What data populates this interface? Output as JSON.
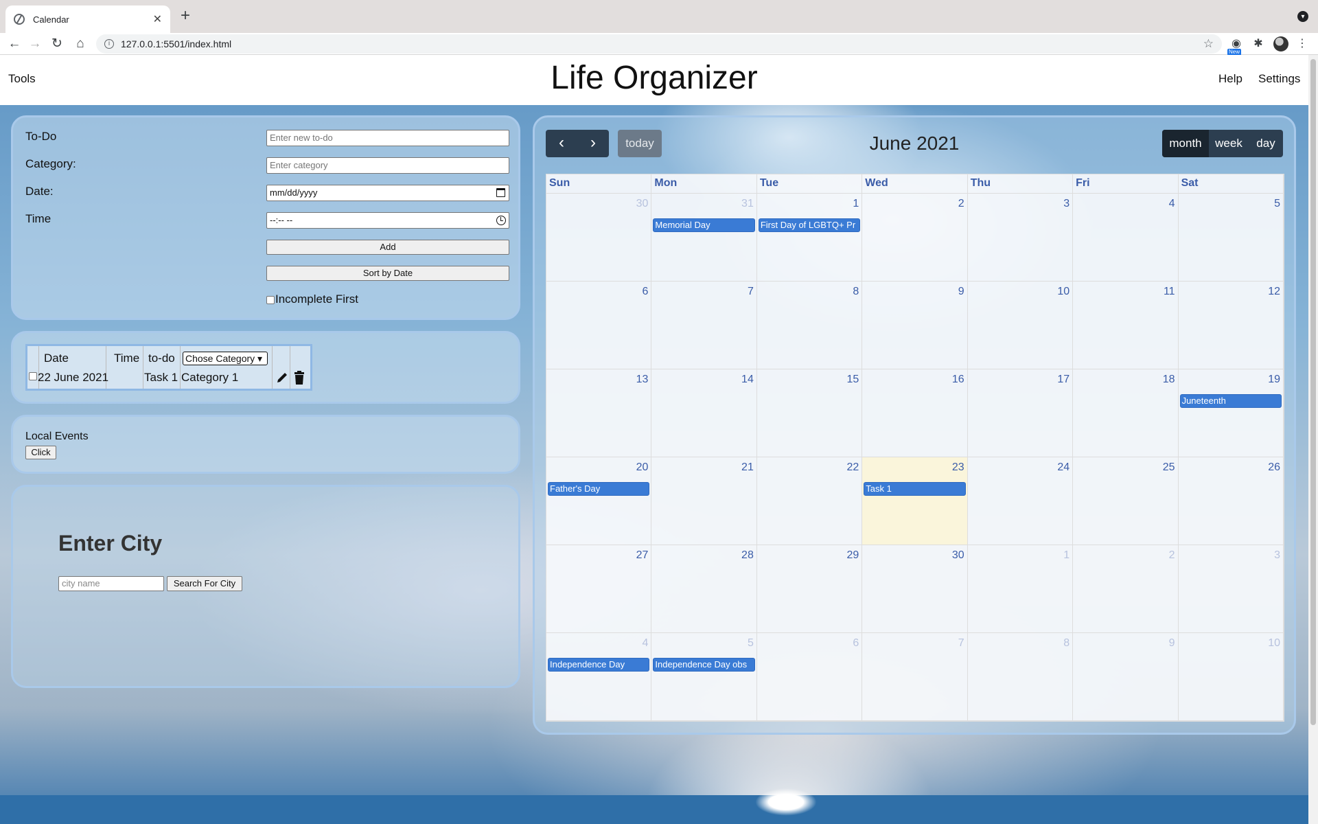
{
  "browser": {
    "tab_title": "Calendar",
    "url": "127.0.0.1:5501/index.html",
    "ext_badge": "New"
  },
  "header": {
    "tools": "Tools",
    "title": "Life Organizer",
    "help": "Help",
    "settings": "Settings"
  },
  "form": {
    "todo_label": "To-Do",
    "todo_placeholder": "Enter new to-do",
    "category_label": "Category:",
    "category_placeholder": "Enter category",
    "date_label": "Date:",
    "date_value": "mm/dd/yyyy",
    "time_label": "Time",
    "time_value": "--:-- --",
    "add_button": "Add",
    "sort_button": "Sort by Date",
    "incomplete_label": "Incomplete First"
  },
  "todo_table": {
    "headers": {
      "date": "Date",
      "time": "Time",
      "todo": "to-do",
      "category_select": "Chose Category"
    },
    "rows": [
      {
        "date": "22 June 2021",
        "time": "",
        "todo": "Task 1",
        "category": "Category 1"
      }
    ]
  },
  "events": {
    "title": "Local Events",
    "button": "Click"
  },
  "weather": {
    "title": "Enter City",
    "input_placeholder": "city name",
    "search_button": "Search For City"
  },
  "calendar": {
    "title": "June 2021",
    "prev_icon": "chevron-left",
    "next_icon": "chevron-right",
    "today_button": "today",
    "views": [
      "month",
      "week",
      "day"
    ],
    "active_view": "month",
    "weekdays": [
      "Sun",
      "Mon",
      "Tue",
      "Wed",
      "Thu",
      "Fri",
      "Sat"
    ],
    "weeks": [
      [
        {
          "n": "30",
          "o": true
        },
        {
          "n": "31",
          "o": true,
          "e": "Memorial Day"
        },
        {
          "n": "1",
          "e": "First Day of LGBTQ+ Pr"
        },
        {
          "n": "2"
        },
        {
          "n": "3"
        },
        {
          "n": "4"
        },
        {
          "n": "5"
        }
      ],
      [
        {
          "n": "6"
        },
        {
          "n": "7"
        },
        {
          "n": "8"
        },
        {
          "n": "9"
        },
        {
          "n": "10"
        },
        {
          "n": "11"
        },
        {
          "n": "12"
        }
      ],
      [
        {
          "n": "13"
        },
        {
          "n": "14"
        },
        {
          "n": "15"
        },
        {
          "n": "16"
        },
        {
          "n": "17"
        },
        {
          "n": "18"
        },
        {
          "n": "19",
          "e": "Juneteenth"
        }
      ],
      [
        {
          "n": "20",
          "e": "Father's Day"
        },
        {
          "n": "21"
        },
        {
          "n": "22"
        },
        {
          "n": "23",
          "t": true,
          "e": "Task 1"
        },
        {
          "n": "24"
        },
        {
          "n": "25"
        },
        {
          "n": "26"
        }
      ],
      [
        {
          "n": "27"
        },
        {
          "n": "28"
        },
        {
          "n": "29"
        },
        {
          "n": "30"
        },
        {
          "n": "1",
          "o": true
        },
        {
          "n": "2",
          "o": true
        },
        {
          "n": "3",
          "o": true
        }
      ],
      [
        {
          "n": "4",
          "o": true,
          "e": "Independence Day"
        },
        {
          "n": "5",
          "o": true,
          "e": "Independence Day obs"
        },
        {
          "n": "6",
          "o": true
        },
        {
          "n": "7",
          "o": true
        },
        {
          "n": "8",
          "o": true
        },
        {
          "n": "9",
          "o": true
        },
        {
          "n": "10",
          "o": true
        }
      ]
    ]
  },
  "colors": {
    "accent": "#3a7bd5",
    "nav_dark": "#2c3e50",
    "today_highlight": "#fcf4d6",
    "day_number": "#3a5ca8"
  }
}
